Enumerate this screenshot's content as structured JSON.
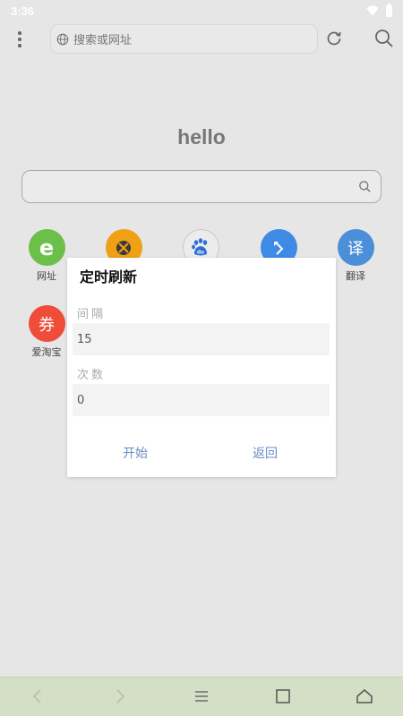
{
  "status_bar": {
    "time": "3:36"
  },
  "top_bar": {
    "url_placeholder": "搜索或网址"
  },
  "home": {
    "greeting": "hello",
    "shortcuts": [
      {
        "label": "网址",
        "glyph": "e",
        "color": "#6cc04a",
        "icon": "ie-icon"
      },
      {
        "label": "",
        "glyph": "",
        "color": "#f0a015",
        "icon": "xbox-icon"
      },
      {
        "label": "",
        "glyph": "du",
        "color": "#ececec",
        "icon": "baidu-paw-icon"
      },
      {
        "label": "",
        "glyph": "",
        "color": "#3d8be5",
        "icon": "share-arrow-icon"
      },
      {
        "label": "翻译",
        "glyph": "译",
        "color": "#4b8fd8",
        "icon": "translate-icon"
      },
      {
        "label": "爱淘宝",
        "glyph": "券",
        "color": "#ef4c3a",
        "icon": "coupon-icon"
      }
    ]
  },
  "dialog": {
    "title": "定时刷新",
    "interval_label": "间隔",
    "interval_value": "15",
    "count_label": "次数",
    "count_value": "0",
    "start_button": "开始",
    "back_button": "返回"
  },
  "colors": {
    "accent": "#6b8cc4",
    "nav_bar": "#d4e0c6",
    "background": "#e6e6e6"
  }
}
